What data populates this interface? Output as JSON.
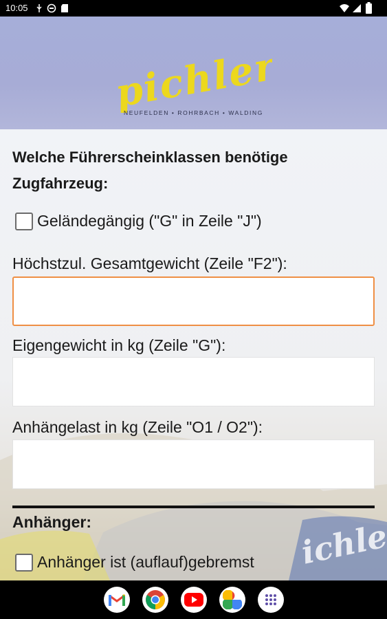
{
  "status_bar": {
    "time": "10:05"
  },
  "banner": {
    "logo_text": "pichler",
    "tagline": "NEUFELDEN • ROHRBACH • WALDING"
  },
  "form": {
    "heading": "Welche Führerscheinklassen benötige Zugfahrzeug:",
    "gelaende_label": "Geländegängig (\"G\" in Zeile \"J\")",
    "gesamtgewicht_label": "Höchstzul. Gesamtgewicht (Zeile \"F2\"):",
    "gesamtgewicht_value": "",
    "eigengewicht_label": "Eigengewicht in kg (Zeile \"G\"):",
    "eigengewicht_value": "",
    "anhaengelast_label": "Anhängelast in kg  (Zeile \"O1 / O2\"):",
    "anhaengelast_value": "",
    "anhaenger_title": "Anhänger:",
    "gebremst_label": "Anhänger ist (auflauf)gebremst"
  },
  "dock": {
    "apps": [
      "Gmail",
      "Chrome",
      "YouTube",
      "Photos",
      "App drawer"
    ]
  },
  "colors": {
    "logo_yellow": "#ecd81d",
    "focus_orange": "#ef8f44",
    "banner_lavender": "#a6aed9"
  }
}
